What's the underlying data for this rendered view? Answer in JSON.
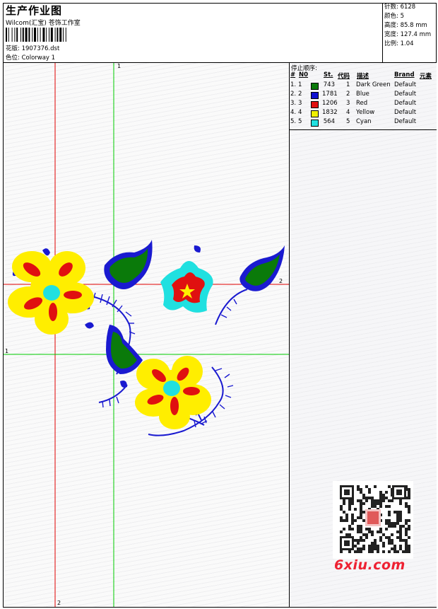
{
  "header": {
    "title": "生产作业图",
    "subtitle": "Wilcom(汇宝) 苍饰工作室",
    "pattern_label": "花版:",
    "pattern_value": "1907376.dst",
    "colorway_label": "色位:",
    "colorway_value": "Colorway 1"
  },
  "stats": [
    {
      "label": "针数:",
      "value": "6128"
    },
    {
      "label": "颜色:",
      "value": "5"
    },
    {
      "label": "高度:",
      "value": "85.8 mm"
    },
    {
      "label": "宽度:",
      "value": "127.4 mm"
    },
    {
      "label": "比例:",
      "value": "1.04"
    }
  ],
  "stop_sequence": {
    "title": "停止顺序:",
    "columns": {
      "num": "#",
      "n": "N0",
      "st": "St.",
      "code": "代码",
      "desc": "描述",
      "brand": "Brand",
      "element": "元素"
    },
    "rows": [
      {
        "num": "1.",
        "n": "1",
        "color": "#0a7a0a",
        "st": "743",
        "code": "1",
        "desc": "Dark Green",
        "brand": "Default"
      },
      {
        "num": "2.",
        "n": "2",
        "color": "#1010d0",
        "st": "1781",
        "code": "2",
        "desc": "Blue",
        "brand": "Default"
      },
      {
        "num": "3.",
        "n": "3",
        "color": "#e01010",
        "st": "1206",
        "code": "3",
        "desc": "Red",
        "brand": "Default"
      },
      {
        "num": "4.",
        "n": "4",
        "color": "#f0f000",
        "st": "1832",
        "code": "4",
        "desc": "Yellow",
        "brand": "Default"
      },
      {
        "num": "5.",
        "n": "5",
        "color": "#20e0e0",
        "st": "564",
        "code": "5",
        "desc": "Cyan",
        "brand": "Default"
      }
    ]
  },
  "axis_labels": {
    "v_green_top": "1",
    "h_red_right": "2",
    "h_green_left": "1",
    "v_red_bottom": "2"
  },
  "watermark": {
    "brand": "6xiu.com",
    "qr_icon": "qr-code-icon"
  },
  "colors": {
    "red_axis": "#e00000",
    "green_axis": "#00cc00"
  }
}
